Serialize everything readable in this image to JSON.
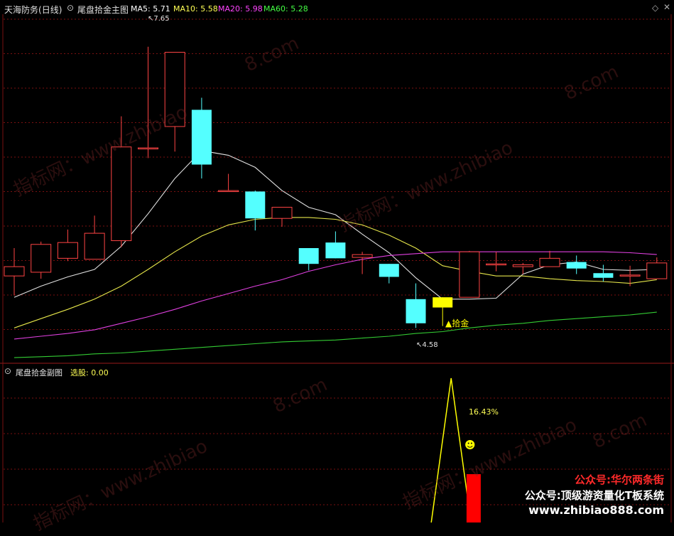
{
  "main_panel": {
    "stock_name": "天海防务",
    "period": "(日线)",
    "indicator_name": "尾盘拾金主图",
    "ma": [
      {
        "label": "MA5:",
        "value": "5.71",
        "color": "#ffffff"
      },
      {
        "label": "MA10:",
        "value": "5.58",
        "color": "#ffff55"
      },
      {
        "label": "MA20:",
        "value": "5.98",
        "color": "#ff44ff"
      },
      {
        "label": "MA60:",
        "value": "5.28",
        "color": "#44ff44"
      }
    ],
    "high_label": "7.65",
    "low_label": "4.58",
    "signal_label": "▲拾金"
  },
  "sub_panel": {
    "indicator_name": "尾盘拾金副图",
    "select_label": "选股:",
    "select_value": "0.00",
    "value_label": "16.43",
    "value_suffix": "%",
    "smile_icon": "smiley-icon"
  },
  "watermarks": [
    "指标网：www.zhibiao",
    "8.com"
  ],
  "promo": {
    "line1": "公众号:华尔两条街",
    "line2": "公众号:顶级游资量化T板系统",
    "line3": "www.zhibiao888.com"
  },
  "colors": {
    "up": "#ff4444",
    "down": "#54ffff",
    "signal": "#ffff00",
    "ma5": "#e0e0e0",
    "ma10": "#e6e64a",
    "ma20": "#e040e0",
    "ma60": "#33cc33",
    "grid": "#7a1010",
    "sub_bar": "#ff0000"
  },
  "chart_data": {
    "type": "candlestick",
    "ylim": [
      4.4,
      8.0
    ],
    "candles": [
      {
        "o": 5.18,
        "c": 5.28,
        "h": 5.48,
        "l": 4.97
      },
      {
        "o": 5.22,
        "c": 5.52,
        "h": 5.55,
        "l": 5.15
      },
      {
        "o": 5.37,
        "c": 5.54,
        "h": 5.68,
        "l": 5.34
      },
      {
        "o": 5.36,
        "c": 5.64,
        "h": 5.83,
        "l": 5.36
      },
      {
        "o": 5.56,
        "c": 6.57,
        "h": 6.9,
        "l": 5.49
      },
      {
        "o": 6.56,
        "c": 6.56,
        "h": 7.65,
        "l": 6.45
      },
      {
        "o": 6.79,
        "c": 7.59,
        "h": 7.59,
        "l": 6.52
      },
      {
        "o": 6.97,
        "c": 6.38,
        "h": 7.1,
        "l": 6.23
      },
      {
        "o": 6.1,
        "c": 6.1,
        "h": 6.28,
        "l": 6.1
      },
      {
        "o": 6.09,
        "c": 5.8,
        "h": 6.1,
        "l": 5.67
      },
      {
        "o": 5.8,
        "c": 5.92,
        "h": 5.86,
        "l": 5.71
      },
      {
        "o": 5.48,
        "c": 5.31,
        "h": 5.48,
        "l": 5.24
      },
      {
        "o": 5.54,
        "c": 5.37,
        "h": 5.66,
        "l": 5.37
      },
      {
        "o": 5.38,
        "c": 5.41,
        "h": 5.44,
        "l": 5.2
      },
      {
        "o": 5.31,
        "c": 5.17,
        "h": 5.31,
        "l": 5.1
      },
      {
        "o": 4.93,
        "c": 4.67,
        "h": 5.1,
        "l": 4.62
      },
      {
        "o": 4.84,
        "c": 4.95,
        "h": 4.95,
        "l": 4.64
      },
      {
        "o": 4.95,
        "c": 5.44,
        "h": 5.45,
        "l": 4.95
      },
      {
        "o": 5.31,
        "c": 5.31,
        "h": 5.44,
        "l": 5.23
      },
      {
        "o": 5.28,
        "c": 5.3,
        "h": 5.32,
        "l": 5.2
      },
      {
        "o": 5.28,
        "c": 5.37,
        "h": 5.45,
        "l": 5.28
      },
      {
        "o": 5.33,
        "c": 5.26,
        "h": 5.4,
        "l": 5.2
      },
      {
        "o": 5.21,
        "c": 5.16,
        "h": 5.3,
        "l": 5.12
      },
      {
        "o": 5.18,
        "c": 5.19,
        "h": 5.29,
        "l": 5.07
      },
      {
        "o": 5.15,
        "c": 5.32,
        "h": 5.38,
        "l": 5.15
      }
    ],
    "signal_index": 16,
    "series": [
      {
        "name": "MA5",
        "values": [
          4.95,
          5.07,
          5.17,
          5.25,
          5.5,
          5.85,
          6.23,
          6.53,
          6.48,
          6.35,
          6.1,
          5.92,
          5.84,
          5.63,
          5.43,
          5.16,
          4.93,
          4.93,
          4.94,
          5.2,
          5.3,
          5.33,
          5.25,
          5.24,
          5.25
        ]
      },
      {
        "name": "MA10",
        "values": [
          4.62,
          4.72,
          4.82,
          4.93,
          5.07,
          5.25,
          5.44,
          5.61,
          5.73,
          5.79,
          5.81,
          5.81,
          5.79,
          5.73,
          5.62,
          5.48,
          5.29,
          5.23,
          5.18,
          5.18,
          5.15,
          5.13,
          5.12,
          5.1,
          5.14
        ]
      },
      {
        "name": "MA20",
        "values": [
          4.5,
          4.53,
          4.56,
          4.6,
          4.67,
          4.74,
          4.82,
          4.91,
          4.99,
          5.07,
          5.14,
          5.23,
          5.3,
          5.36,
          5.4,
          5.42,
          5.44,
          5.44,
          5.44,
          5.44,
          5.44,
          5.44,
          5.44,
          5.43,
          5.41
        ]
      },
      {
        "name": "MA60",
        "values": [
          4.3,
          4.31,
          4.32,
          4.34,
          4.35,
          4.37,
          4.39,
          4.41,
          4.43,
          4.45,
          4.47,
          4.48,
          4.49,
          4.51,
          4.53,
          4.56,
          4.58,
          4.62,
          4.65,
          4.67,
          4.7,
          4.72,
          4.74,
          4.76,
          4.79
        ]
      }
    ],
    "sub": {
      "peak_index": 16,
      "peak_value": 100,
      "bar_index": 17,
      "bar_value": 16.43
    }
  }
}
